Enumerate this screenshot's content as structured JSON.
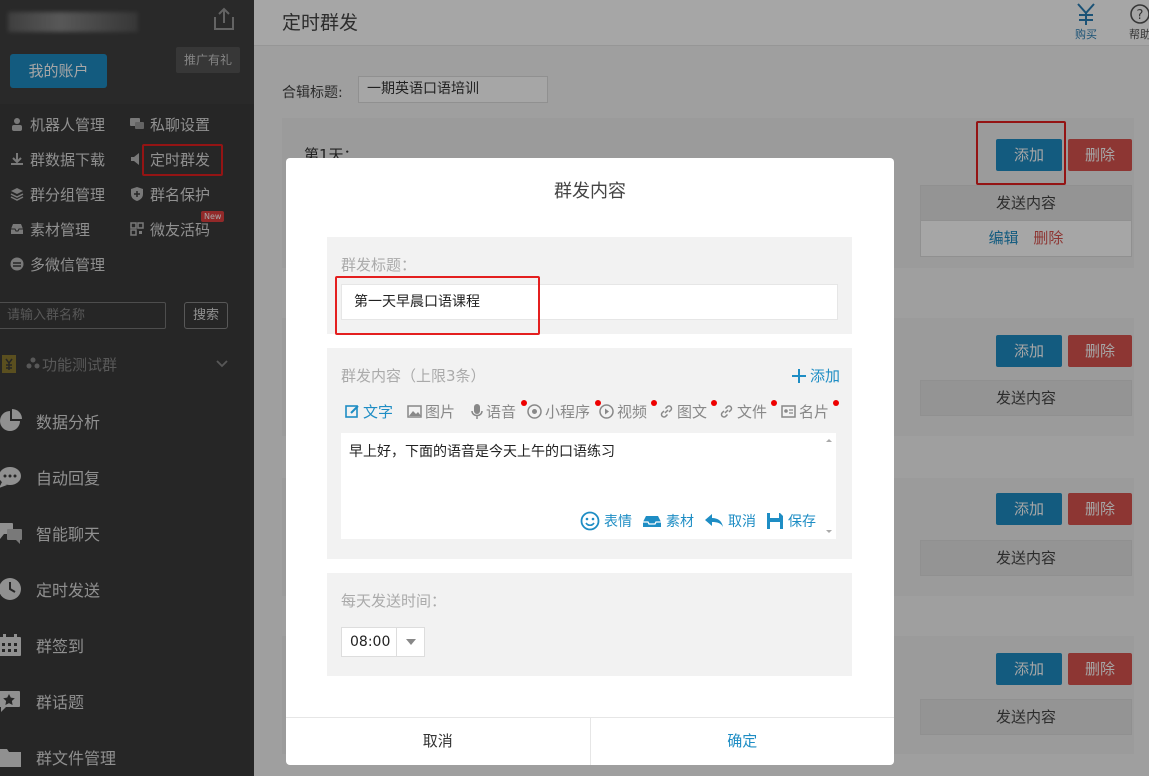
{
  "sidebar": {
    "promo": "推广有礼",
    "account_button": "我的账户",
    "links": [
      {
        "label": "机器人管理",
        "icon": "robot-icon"
      },
      {
        "label": "私聊设置",
        "icon": "chat-icon"
      },
      {
        "label": "群数据下载",
        "icon": "download-icon"
      },
      {
        "label": "定时群发",
        "icon": "broadcast-icon"
      },
      {
        "label": "群分组管理",
        "icon": "layers-icon"
      },
      {
        "label": "群名保护",
        "icon": "shield-icon"
      },
      {
        "label": "素材管理",
        "icon": "inbox-icon"
      },
      {
        "label": "微友活码",
        "icon": "qrcode-icon"
      },
      {
        "label": "多微信管理",
        "icon": "wechat-icon"
      }
    ],
    "new_badge": "New",
    "search_placeholder": "请输入群名称",
    "search_button": "搜索",
    "group_select": "功能测试群",
    "menu": [
      {
        "label": "数据分析",
        "icon": "pie-chart-icon"
      },
      {
        "label": "自动回复",
        "icon": "chat-bubble-icon"
      },
      {
        "label": "智能聊天",
        "icon": "chats-icon"
      },
      {
        "label": "定时发送",
        "icon": "clock-icon"
      },
      {
        "label": "群签到",
        "icon": "calendar-icon"
      },
      {
        "label": "群话题",
        "icon": "star-chat-icon"
      },
      {
        "label": "群文件管理",
        "icon": "folder-icon"
      }
    ]
  },
  "header": {
    "title": "定时群发",
    "buy_label": "购买",
    "help_label": "帮助"
  },
  "main": {
    "collection_label": "合辑标题:",
    "collection_value": "一期英语口语培训",
    "day1_label": "第1天：",
    "add_button": "添加",
    "delete_button": "删除",
    "send_content_header": "发送内容",
    "edit_link": "编辑",
    "delete_link": "删除"
  },
  "modal": {
    "title": "群发内容",
    "title_label": "群发标题：",
    "title_value": "第一天早晨口语课程",
    "content_label": "群发内容（上限3条）",
    "add_link": "添加",
    "tabs": [
      "文字",
      "图片",
      "语音",
      "小程序",
      "视频",
      "图文",
      "文件",
      "名片"
    ],
    "content_text": "早上好，下面的语音是今天上午的口语练习",
    "tools": [
      "表情",
      "素材",
      "取消",
      "保存"
    ],
    "time_label": "每天发送时间：",
    "time_value": "08:00",
    "cancel": "取消",
    "confirm": "确定"
  },
  "colors": {
    "primary": "#1e8dc4",
    "danger": "#d9534f",
    "highlight": "#e41f1f",
    "sidebar": "#3b3b3b"
  }
}
